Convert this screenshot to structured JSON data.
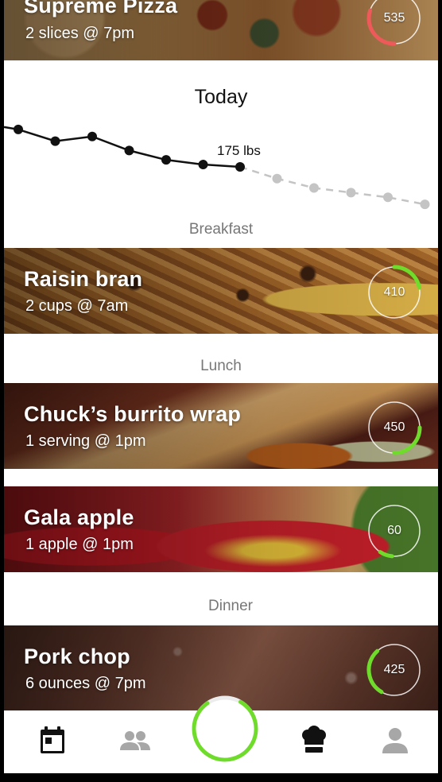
{
  "colors": {
    "accent_green": "#6fdc2b",
    "over_red": "#ee5a5a",
    "ring_track": "rgba(255,255,255,0.8)",
    "tab_active": "#111111",
    "tab_inactive": "#a7a7a7"
  },
  "today": {
    "title": "Today",
    "current_weight_label": "175 lbs"
  },
  "weight_chart": {
    "type": "line",
    "series": [
      {
        "style": "solid",
        "values": [
          183,
          180.5,
          181.5,
          178.5,
          176.5,
          175.5,
          175
        ]
      },
      {
        "style": "dashed",
        "values": [
          175,
          172.5,
          170.5,
          169.5,
          168.5,
          167
        ]
      }
    ]
  },
  "sections": {
    "breakfast": "Breakfast",
    "lunch": "Lunch",
    "dinner": "Dinner"
  },
  "entries": [
    {
      "name": "Supreme Pizza",
      "detail": "2 slices @ 7pm",
      "calories": "535",
      "progress": 0.3,
      "ring_color": "#ee5a5a"
    },
    {
      "name": "Raisin bran",
      "detail": "2 cups @ 7am",
      "calories": "410",
      "progress": 0.22,
      "ring_color": "#6fdc2b"
    },
    {
      "name": "Chuck’s burrito wrap",
      "detail": "1 serving @ 1pm",
      "calories": "450",
      "progress": 0.25,
      "ring_color": "#6fdc2b"
    },
    {
      "name": "Gala apple",
      "detail": "1 apple @ 1pm",
      "calories": "60",
      "progress": 0.08,
      "ring_color": "#6fdc2b"
    },
    {
      "name": "Pork chop",
      "detail": "6 ounces @ 7pm",
      "calories": "425",
      "progress": 0.3,
      "ring_color": "#6fdc2b"
    }
  ],
  "tabbar": {
    "daily_progress": 0.82,
    "tabs": [
      {
        "icon": "calendar-icon",
        "active": true
      },
      {
        "icon": "people-icon",
        "active": false
      },
      {
        "icon": "chef-hat-icon",
        "active": false
      },
      {
        "icon": "profile-icon",
        "active": false
      }
    ]
  }
}
